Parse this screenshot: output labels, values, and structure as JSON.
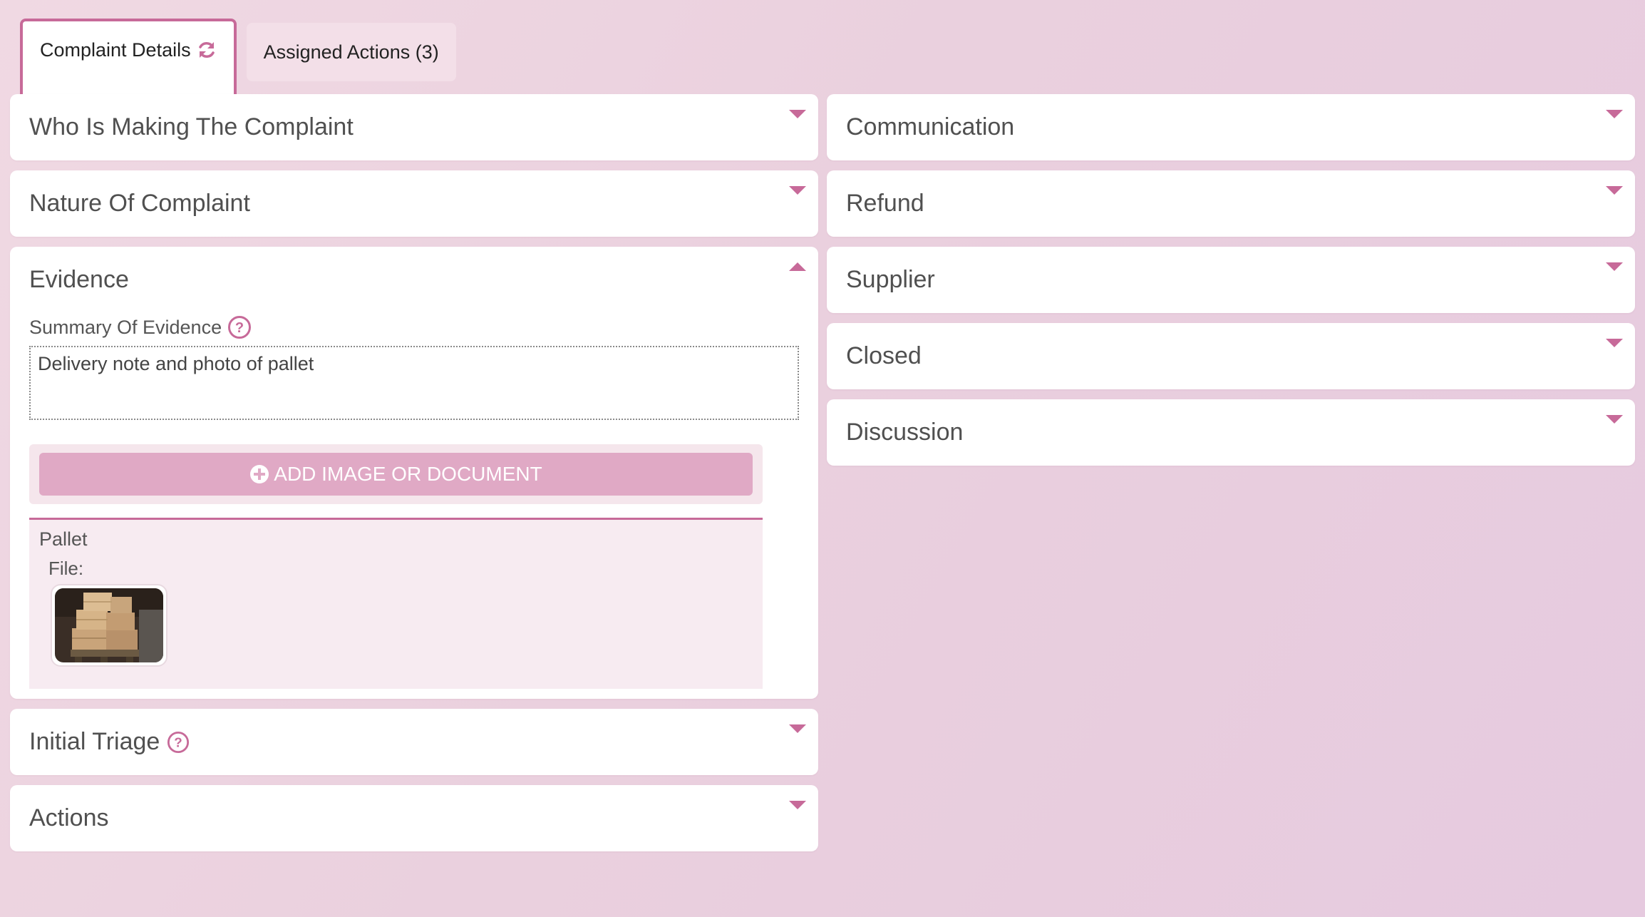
{
  "tabs": [
    {
      "label": "Complaint Details",
      "active": true,
      "icon": "refresh-icon"
    },
    {
      "label": "Assigned Actions (3)",
      "active": false
    }
  ],
  "left_panels": {
    "who": {
      "title": "Who Is Making The Complaint",
      "expanded": false
    },
    "nature": {
      "title": "Nature Of Complaint",
      "expanded": false
    },
    "evidence": {
      "title": "Evidence",
      "expanded": true,
      "summary_label": "Summary Of Evidence",
      "summary_value": "Delivery note and photo of pallet",
      "upload_label": "ADD IMAGE OR DOCUMENT",
      "attachment": {
        "title": "Pallet",
        "file_label": "File:",
        "thumbnail": "pallet-photo"
      }
    },
    "triage": {
      "title": "Initial Triage",
      "expanded": false
    },
    "actions": {
      "title": "Actions",
      "expanded": false
    }
  },
  "right_panels": {
    "communication": {
      "title": "Communication",
      "expanded": false
    },
    "refund": {
      "title": "Refund",
      "expanded": false
    },
    "supplier": {
      "title": "Supplier",
      "expanded": false
    },
    "closed": {
      "title": "Closed",
      "expanded": false
    },
    "discussion": {
      "title": "Discussion",
      "expanded": false
    }
  },
  "colors": {
    "accent": "#c76a99",
    "upload_button": "#e0a9c5",
    "background": "#ecd3e0",
    "panel": "#ffffff"
  }
}
